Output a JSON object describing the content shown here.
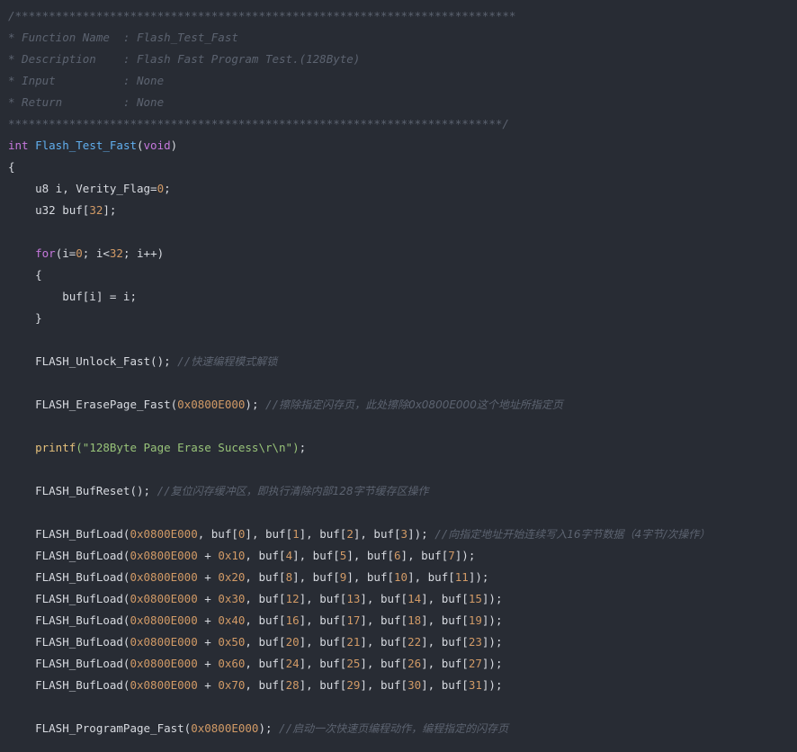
{
  "editor": {
    "theme_colors": {
      "background": "#282c34",
      "comment": "#5c6370",
      "keyword": "#c678dd",
      "function": "#61afef",
      "number": "#d19a66",
      "string": "#98c379",
      "builtin": "#e5c07b",
      "plain": "#d7dae0"
    },
    "lines": [
      [
        {
          "t": "comment",
          "v": "/**************************************************************************"
        }
      ],
      [
        {
          "t": "comment",
          "v": "* Function Name  : Flash_Test_Fast"
        }
      ],
      [
        {
          "t": "comment",
          "v": "* Description    : Flash Fast Program Test.(128Byte)"
        }
      ],
      [
        {
          "t": "comment",
          "v": "* Input          : None"
        }
      ],
      [
        {
          "t": "comment",
          "v": "* Return         : None"
        }
      ],
      [
        {
          "t": "comment",
          "v": "*************************************************************************/"
        }
      ],
      [
        {
          "t": "keyword",
          "v": "int"
        },
        {
          "t": "plain",
          "v": " "
        },
        {
          "t": "func",
          "v": "Flash_Test_Fast"
        },
        {
          "t": "plain",
          "v": "("
        },
        {
          "t": "keyword",
          "v": "void"
        },
        {
          "t": "plain",
          "v": ")"
        }
      ],
      [
        {
          "t": "plain",
          "v": "{"
        }
      ],
      [
        {
          "t": "plain",
          "v": "    u8 i, Verity_Flag="
        },
        {
          "t": "number",
          "v": "0"
        },
        {
          "t": "plain",
          "v": ";"
        }
      ],
      [
        {
          "t": "plain",
          "v": "    u32 buf["
        },
        {
          "t": "number",
          "v": "32"
        },
        {
          "t": "plain",
          "v": "];"
        }
      ],
      [],
      [
        {
          "t": "plain",
          "v": "    "
        },
        {
          "t": "keyword",
          "v": "for"
        },
        {
          "t": "plain",
          "v": "(i="
        },
        {
          "t": "number",
          "v": "0"
        },
        {
          "t": "plain",
          "v": "; i<"
        },
        {
          "t": "number",
          "v": "32"
        },
        {
          "t": "plain",
          "v": "; i++)"
        }
      ],
      [
        {
          "t": "plain",
          "v": "    {"
        }
      ],
      [
        {
          "t": "plain",
          "v": "        buf[i] = i;"
        }
      ],
      [
        {
          "t": "plain",
          "v": "    }"
        }
      ],
      [],
      [
        {
          "t": "plain",
          "v": "    FLASH_Unlock_Fast(); "
        },
        {
          "t": "comment",
          "v": "//"
        },
        {
          "t": "commentzh",
          "v": "快速编程模式解锁"
        }
      ],
      [],
      [
        {
          "t": "plain",
          "v": "    FLASH_ErasePage_Fast("
        },
        {
          "t": "number",
          "v": "0x0800E000"
        },
        {
          "t": "plain",
          "v": "); "
        },
        {
          "t": "comment",
          "v": "//"
        },
        {
          "t": "commentzh",
          "v": "擦除指定闪存页，此处擦除0x0800E000这个地址所指定页"
        }
      ],
      [],
      [
        {
          "t": "plain",
          "v": "    "
        },
        {
          "t": "builtin",
          "v": "printf"
        },
        {
          "t": "string",
          "v": "(\"128Byte Page Erase Sucess\\r\\n\")"
        },
        {
          "t": "plain",
          "v": ";"
        }
      ],
      [],
      [
        {
          "t": "plain",
          "v": "    FLASH_BufReset(); "
        },
        {
          "t": "comment",
          "v": "//"
        },
        {
          "t": "commentzh",
          "v": "复位闪存缓冲区，即执行清除内部128字节缓存区操作"
        }
      ],
      [],
      [
        {
          "t": "plain",
          "v": "    FLASH_BufLoad("
        },
        {
          "t": "number",
          "v": "0x0800E000"
        },
        {
          "t": "plain",
          "v": ", buf["
        },
        {
          "t": "number",
          "v": "0"
        },
        {
          "t": "plain",
          "v": "], buf["
        },
        {
          "t": "number",
          "v": "1"
        },
        {
          "t": "plain",
          "v": "], buf["
        },
        {
          "t": "number",
          "v": "2"
        },
        {
          "t": "plain",
          "v": "], buf["
        },
        {
          "t": "number",
          "v": "3"
        },
        {
          "t": "plain",
          "v": "]); "
        },
        {
          "t": "comment",
          "v": "//"
        },
        {
          "t": "commentzh",
          "v": "向指定地址开始连续写入16字节数据（4字节/次操作）"
        }
      ],
      [
        {
          "t": "plain",
          "v": "    FLASH_BufLoad("
        },
        {
          "t": "number",
          "v": "0x0800E000"
        },
        {
          "t": "plain",
          "v": " + "
        },
        {
          "t": "number",
          "v": "0x10"
        },
        {
          "t": "plain",
          "v": ", buf["
        },
        {
          "t": "number",
          "v": "4"
        },
        {
          "t": "plain",
          "v": "], buf["
        },
        {
          "t": "number",
          "v": "5"
        },
        {
          "t": "plain",
          "v": "], buf["
        },
        {
          "t": "number",
          "v": "6"
        },
        {
          "t": "plain",
          "v": "], buf["
        },
        {
          "t": "number",
          "v": "7"
        },
        {
          "t": "plain",
          "v": "]);"
        }
      ],
      [
        {
          "t": "plain",
          "v": "    FLASH_BufLoad("
        },
        {
          "t": "number",
          "v": "0x0800E000"
        },
        {
          "t": "plain",
          "v": " + "
        },
        {
          "t": "number",
          "v": "0x20"
        },
        {
          "t": "plain",
          "v": ", buf["
        },
        {
          "t": "number",
          "v": "8"
        },
        {
          "t": "plain",
          "v": "], buf["
        },
        {
          "t": "number",
          "v": "9"
        },
        {
          "t": "plain",
          "v": "], buf["
        },
        {
          "t": "number",
          "v": "10"
        },
        {
          "t": "plain",
          "v": "], buf["
        },
        {
          "t": "number",
          "v": "11"
        },
        {
          "t": "plain",
          "v": "]);"
        }
      ],
      [
        {
          "t": "plain",
          "v": "    FLASH_BufLoad("
        },
        {
          "t": "number",
          "v": "0x0800E000"
        },
        {
          "t": "plain",
          "v": " + "
        },
        {
          "t": "number",
          "v": "0x30"
        },
        {
          "t": "plain",
          "v": ", buf["
        },
        {
          "t": "number",
          "v": "12"
        },
        {
          "t": "plain",
          "v": "], buf["
        },
        {
          "t": "number",
          "v": "13"
        },
        {
          "t": "plain",
          "v": "], buf["
        },
        {
          "t": "number",
          "v": "14"
        },
        {
          "t": "plain",
          "v": "], buf["
        },
        {
          "t": "number",
          "v": "15"
        },
        {
          "t": "plain",
          "v": "]);"
        }
      ],
      [
        {
          "t": "plain",
          "v": "    FLASH_BufLoad("
        },
        {
          "t": "number",
          "v": "0x0800E000"
        },
        {
          "t": "plain",
          "v": " + "
        },
        {
          "t": "number",
          "v": "0x40"
        },
        {
          "t": "plain",
          "v": ", buf["
        },
        {
          "t": "number",
          "v": "16"
        },
        {
          "t": "plain",
          "v": "], buf["
        },
        {
          "t": "number",
          "v": "17"
        },
        {
          "t": "plain",
          "v": "], buf["
        },
        {
          "t": "number",
          "v": "18"
        },
        {
          "t": "plain",
          "v": "], buf["
        },
        {
          "t": "number",
          "v": "19"
        },
        {
          "t": "plain",
          "v": "]);"
        }
      ],
      [
        {
          "t": "plain",
          "v": "    FLASH_BufLoad("
        },
        {
          "t": "number",
          "v": "0x0800E000"
        },
        {
          "t": "plain",
          "v": " + "
        },
        {
          "t": "number",
          "v": "0x50"
        },
        {
          "t": "plain",
          "v": ", buf["
        },
        {
          "t": "number",
          "v": "20"
        },
        {
          "t": "plain",
          "v": "], buf["
        },
        {
          "t": "number",
          "v": "21"
        },
        {
          "t": "plain",
          "v": "], buf["
        },
        {
          "t": "number",
          "v": "22"
        },
        {
          "t": "plain",
          "v": "], buf["
        },
        {
          "t": "number",
          "v": "23"
        },
        {
          "t": "plain",
          "v": "]);"
        }
      ],
      [
        {
          "t": "plain",
          "v": "    FLASH_BufLoad("
        },
        {
          "t": "number",
          "v": "0x0800E000"
        },
        {
          "t": "plain",
          "v": " + "
        },
        {
          "t": "number",
          "v": "0x60"
        },
        {
          "t": "plain",
          "v": ", buf["
        },
        {
          "t": "number",
          "v": "24"
        },
        {
          "t": "plain",
          "v": "], buf["
        },
        {
          "t": "number",
          "v": "25"
        },
        {
          "t": "plain",
          "v": "], buf["
        },
        {
          "t": "number",
          "v": "26"
        },
        {
          "t": "plain",
          "v": "], buf["
        },
        {
          "t": "number",
          "v": "27"
        },
        {
          "t": "plain",
          "v": "]);"
        }
      ],
      [
        {
          "t": "plain",
          "v": "    FLASH_BufLoad("
        },
        {
          "t": "number",
          "v": "0x0800E000"
        },
        {
          "t": "plain",
          "v": " + "
        },
        {
          "t": "number",
          "v": "0x70"
        },
        {
          "t": "plain",
          "v": ", buf["
        },
        {
          "t": "number",
          "v": "28"
        },
        {
          "t": "plain",
          "v": "], buf["
        },
        {
          "t": "number",
          "v": "29"
        },
        {
          "t": "plain",
          "v": "], buf["
        },
        {
          "t": "number",
          "v": "30"
        },
        {
          "t": "plain",
          "v": "], buf["
        },
        {
          "t": "number",
          "v": "31"
        },
        {
          "t": "plain",
          "v": "]);"
        }
      ],
      [],
      [
        {
          "t": "plain",
          "v": "    FLASH_ProgramPage_Fast("
        },
        {
          "t": "number",
          "v": "0x0800E000"
        },
        {
          "t": "plain",
          "v": "); "
        },
        {
          "t": "comment",
          "v": "//"
        },
        {
          "t": "commentzh",
          "v": "启动一次快速页编程动作，编程指定的闪存页"
        }
      ]
    ]
  }
}
